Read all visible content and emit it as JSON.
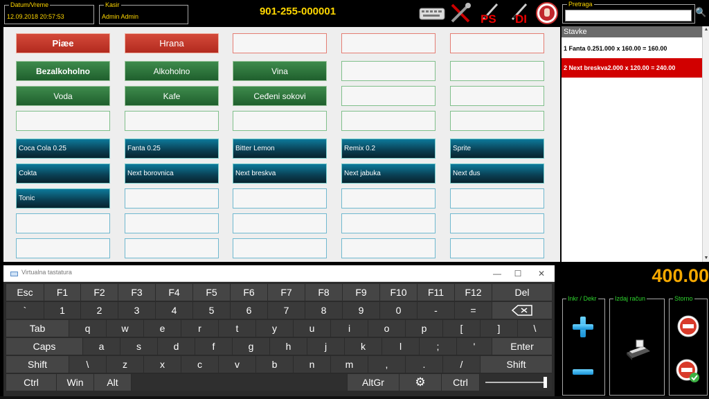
{
  "header": {
    "datetime_label": "Datum/Vreme",
    "datetime_value": "12.09.2018 20:57:53",
    "cashier_label": "Kasir",
    "cashier_value": "Admin Admin",
    "receipt_number": "901-255-000001",
    "ps_label": "PS",
    "di_label": "DI",
    "search_label": "Pretraga",
    "search_value": ""
  },
  "grid": {
    "categories_row1": [
      "Piæe",
      "Hrana"
    ],
    "categories_row2": [
      "Bezalkoholno",
      "Alkoholno",
      "Vina"
    ],
    "categories_row3": [
      "Voda",
      "Kafe",
      "Ceđeni sokovi"
    ],
    "products_row1": [
      "Coca Cola 0.25",
      "Fanta 0.25",
      "Bitter Lemon",
      "Remix 0.2",
      "Sprite"
    ],
    "products_row2": [
      "Cokta",
      "Next borovnica",
      "Next breskva",
      "Next jabuka",
      "Next đus"
    ],
    "products_row3": [
      "Tonic"
    ]
  },
  "stavke": {
    "title": "Stavke",
    "items": [
      "1 Fanta 0.251.000 x 160.00 = 160.00",
      "2 Next breskva2.000 x 120.00 = 240.00"
    ]
  },
  "total": "400.00",
  "groups": {
    "inkr_label": "Inkr / Dekr",
    "izdaj_label": "Izdaj račun",
    "storno_label": "Storno"
  },
  "keyboard": {
    "title": "Virtualna tastatura",
    "row1": [
      "Esc",
      "F1",
      "F2",
      "F3",
      "F4",
      "F5",
      "F6",
      "F7",
      "F8",
      "F9",
      "F10",
      "F11",
      "F12",
      "Del"
    ],
    "row2": [
      "`",
      "1",
      "2",
      "3",
      "4",
      "5",
      "6",
      "7",
      "8",
      "9",
      "0",
      "-",
      "="
    ],
    "row3": [
      "Tab",
      "q",
      "w",
      "e",
      "r",
      "t",
      "y",
      "u",
      "i",
      "o",
      "p",
      "[",
      "]",
      "\\"
    ],
    "row4": [
      "Caps",
      "a",
      "s",
      "d",
      "f",
      "g",
      "h",
      "j",
      "k",
      "l",
      ";",
      "'",
      "Enter"
    ],
    "row5": [
      "Shift",
      "\\",
      "z",
      "x",
      "c",
      "v",
      "b",
      "n",
      "m",
      ",",
      ".",
      "/",
      "Shift"
    ],
    "row6": [
      "Ctrl",
      "Win",
      "Alt",
      "AltGr",
      "Ctrl"
    ]
  },
  "colors": {
    "accent_yellow": "#ffd700",
    "total_orange": "#f5a800",
    "legend_green": "#2fd52f",
    "selected_red": "#d10000"
  }
}
